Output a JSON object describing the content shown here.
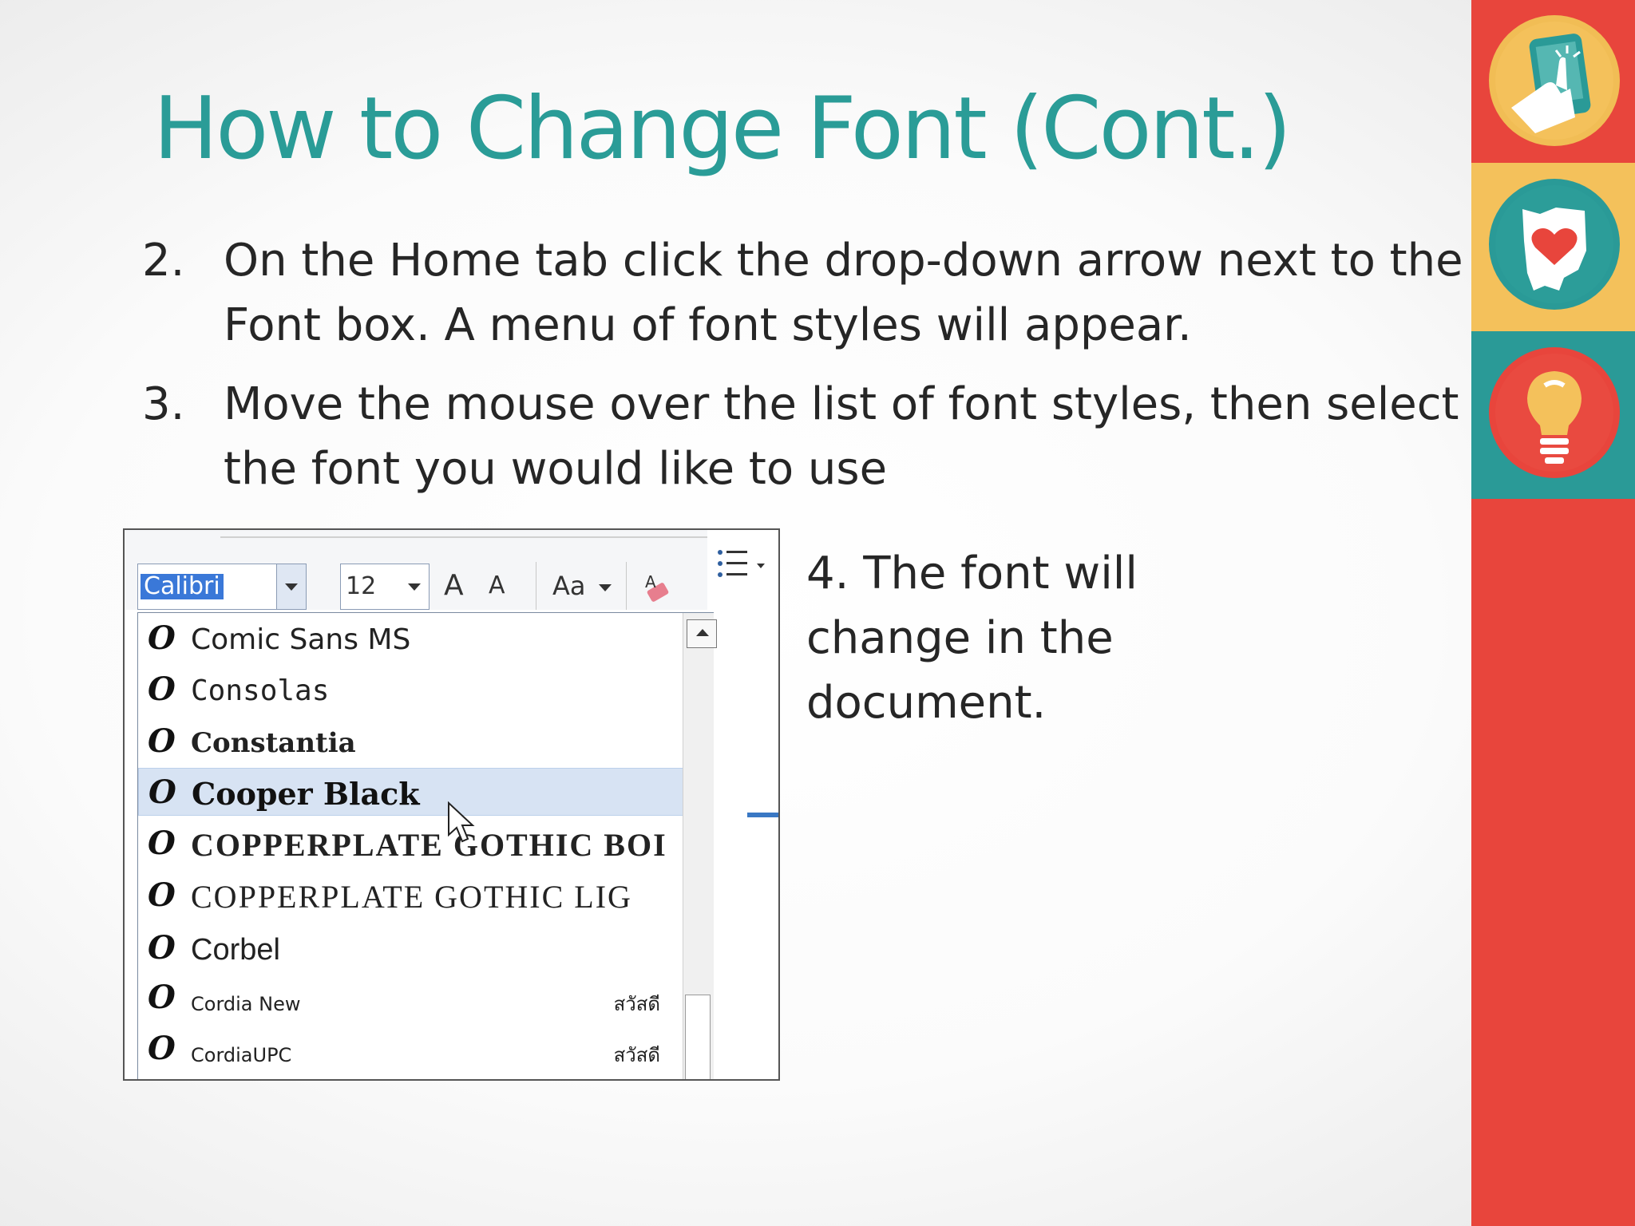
{
  "slide": {
    "title": "How to Change Font (Cont.)",
    "steps": [
      {
        "num": "2.",
        "text": "On the Home tab click the drop-down arrow next to the Font box.  A menu of font styles will appear."
      },
      {
        "num": "3.",
        "text": "Move the mouse over the list of font styles, then select the font you would like to use"
      }
    ],
    "step4": "4.  The font will change in the document."
  },
  "ribbon": {
    "font_value": "Calibri",
    "size_value": "12",
    "grow_label": "A",
    "shrink_label": "A",
    "case_label": "Aa"
  },
  "dropdown": {
    "items": [
      {
        "name": "Comic Sans MS"
      },
      {
        "name": "Consolas"
      },
      {
        "name": "Constantia"
      },
      {
        "name": "Cooper Black",
        "highlighted": true
      },
      {
        "name": "COPPERPLATE GOTHIC BOI"
      },
      {
        "name": "COPPERPLATE GOTHIC LIG"
      },
      {
        "name": "Corbel"
      },
      {
        "name": "Cordia New",
        "sample": "สวัสดี"
      },
      {
        "name": "CordiaUPC",
        "sample": "สวัสดี"
      }
    ],
    "item_icon": "O"
  },
  "icons": [
    "tablet-touch-icon",
    "ohio-heart-icon",
    "lightbulb-icon",
    "mouse-cursor-icon"
  ],
  "colors": {
    "title": "#2a9c97",
    "sidebar_red": "#e8453c",
    "sidebar_yellow": "#f4c15b",
    "sidebar_teal": "#2a9a97",
    "highlight": "#d7e3f3"
  }
}
